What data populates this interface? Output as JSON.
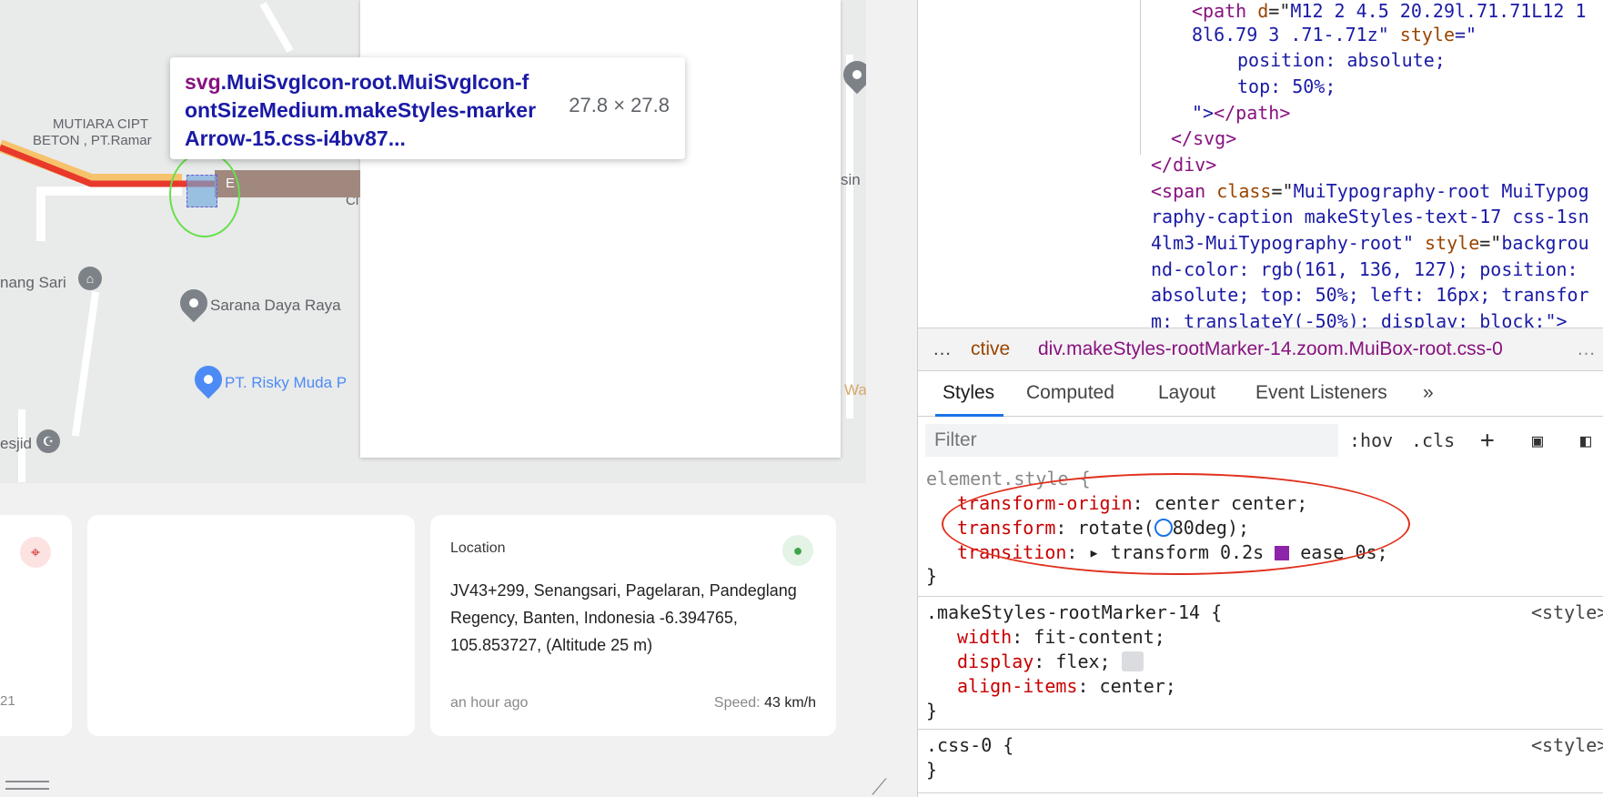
{
  "map": {
    "labels": {
      "mutiara_line1": "MUTIARA CIPT",
      "mutiara_line2": "BETON , PT.Ramar",
      "nang_sari": "nang Sari",
      "sarana": "Sarana Daya Raya",
      "risky": "PT. Risky Muda P",
      "esjid": "esjid",
      "sin": "sin",
      "wa": "Wa",
      "ci": "Cl",
      "marker_text": "E"
    },
    "tooltip": {
      "tag": "svg",
      "selector": ".MuiSvgIcon-root.MuiSvgIcon-fontSizeMedium.makeStyles-markerArrow-15.css-i4bv87...",
      "size": "27.8 × 27.8"
    }
  },
  "cards": {
    "left_date": "21",
    "location": {
      "title": "Location",
      "address": "JV43+299, Senangsari, Pagelaran, Pandeglang Regency, Banten, Indonesia -6.394765, 105.853727, (Altitude 25 m)",
      "time": "an hour ago",
      "speed_label": "Speed:",
      "speed_value": "43 km/h"
    }
  },
  "devtools": {
    "dom": {
      "l1_a": "<path ",
      "l1_attr": "d",
      "l1_eq": "=\"",
      "l1_val": "M12 2 4.5 20.29l.71.71L12 1",
      "l2_val": "8l6.79 3 .71-.71z",
      "l2_q": "\" ",
      "l2_attr": "style",
      "l2_eq": "=\"",
      "l3": "position: absolute;",
      "l4": "top: 50%;",
      "l5_a": "\">",
      "l5_b": "</path>",
      "l6": "</svg>",
      "l7": "</div>",
      "l8_a": "<span ",
      "l8_attr": "class",
      "l8_eq": "=\"",
      "l8_val": "MuiTypography-root MuiTypog",
      "l9_val": "raphy-caption makeStyles-text-17 css-1sn",
      "l10_val": "4lm3-MuiTypography-root",
      "l10_q": "\" ",
      "l10_attr": "style",
      "l10_eq": "=\"",
      "l10_val2": "backgrou",
      "l11": "nd-color: rgb(161, 136, 127); position:",
      "l12": "absolute; top: 50%; left: 16px; transfor",
      "l13": "m: translateY(-50%); display: block;\">"
    },
    "breadcrumbs": {
      "left_ellipsis": "…",
      "crumb1": "ctive",
      "crumb2": "div.makeStyles-rootMarker-14.zoom.MuiBox-root.css-0",
      "right_ellipsis": "…"
    },
    "tabs": [
      "Styles",
      "Computed",
      "Layout",
      "Event Listeners",
      "»"
    ],
    "filter": {
      "placeholder": "Filter",
      "hov": ":hov",
      "cls": ".cls",
      "plus": "+"
    },
    "rules": {
      "element_style": {
        "selector": "element.style {",
        "p1": "transform-origin",
        "v1": ": center center;",
        "p2": "transform",
        "v2a": ": rotate(",
        "v2b": "80deg);",
        "p3": "transition",
        "v3a": ": ▸ transform 0.2s ",
        "v3b": "ease 0s;",
        "close": "}"
      },
      "root_marker": {
        "selector": ".makeStyles-rootMarker-14 {",
        "source": "<style>",
        "p1": "width",
        "v1": ": fit-content;",
        "p2": "display",
        "v2": ": flex;",
        "p3": "align-items",
        "v3": ": center;",
        "close": "}"
      },
      "css0": {
        "selector": ".css-0 {",
        "source": "<style>",
        "close": "}"
      }
    }
  }
}
